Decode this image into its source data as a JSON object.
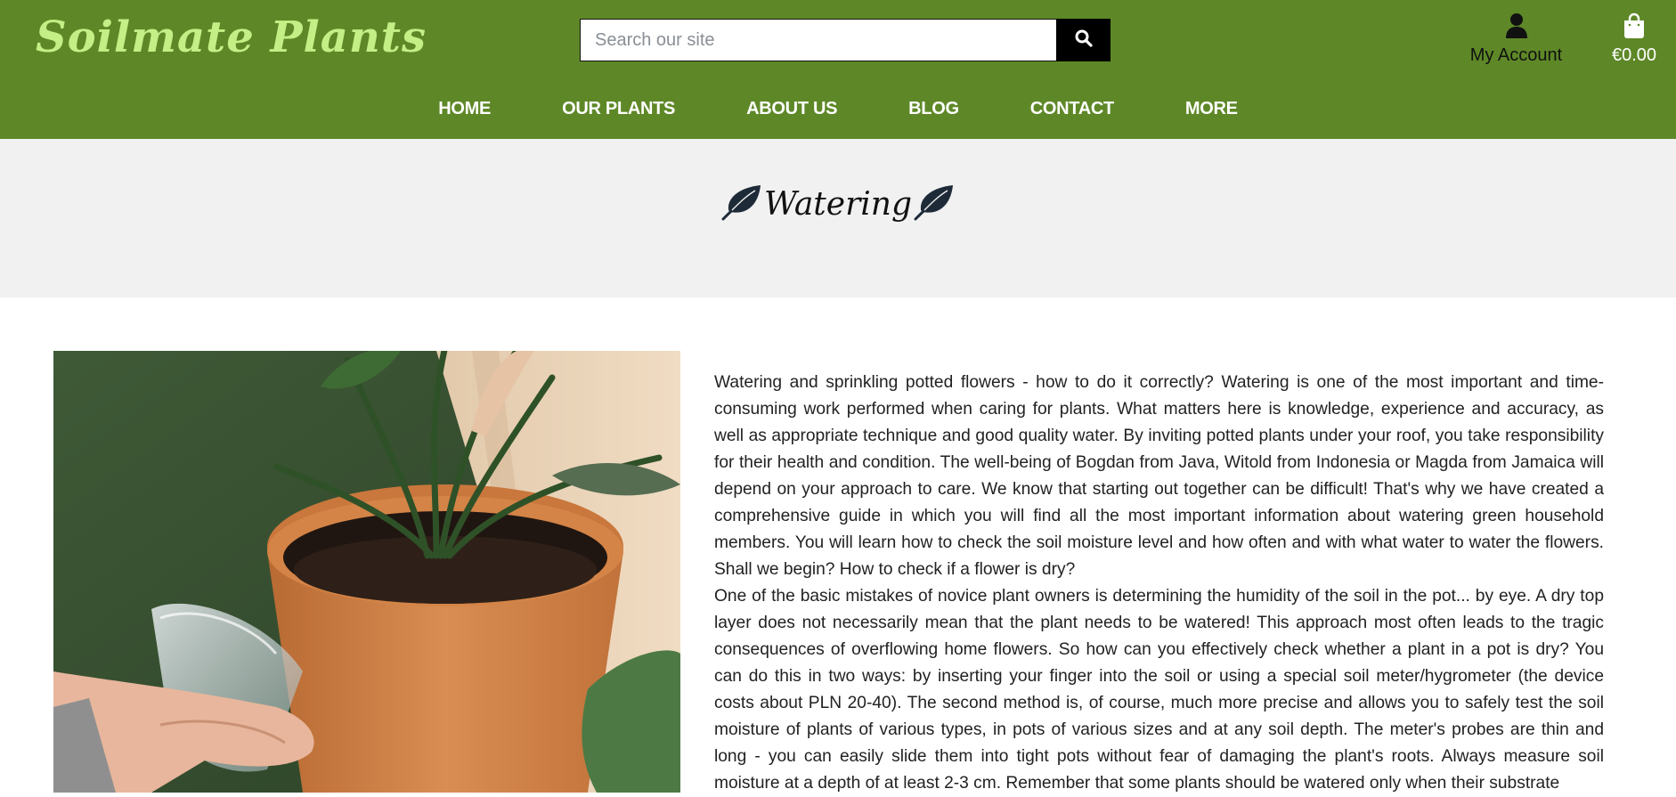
{
  "header": {
    "brand": "Soilmate Plants",
    "search": {
      "placeholder": "Search our site",
      "value": ""
    },
    "account_label": "My Account",
    "cart_total": "€0.00"
  },
  "nav": {
    "items": [
      {
        "label": "HOME"
      },
      {
        "label": "OUR PLANTS"
      },
      {
        "label": "ABOUT US"
      },
      {
        "label": "BLOG"
      },
      {
        "label": "CONTACT"
      },
      {
        "label": "MORE"
      }
    ]
  },
  "banner": {
    "title": "Watering"
  },
  "article": {
    "paragraphs": [
      "Watering and sprinkling potted flowers - how to do it correctly? Watering is one of the most important and time-consuming work performed when caring for plants. What matters here is knowledge, experience and accuracy, as well as appropriate technique and good quality water. By inviting potted plants under your roof, you take responsibility for their health and condition. The well-being of Bogdan from Java, Witold from Indonesia or Magda from Jamaica will depend on your approach to care. We know that starting out together can be difficult! That's why we have created a comprehensive guide in which you will find all the most important information about watering green household members. You will learn how to check the soil moisture level and how often and with what water to water the flowers. Shall we begin? How to check if a flower is dry?",
      "One of the basic mistakes of novice plant owners is determining the humidity of the soil in the pot... by eye. A dry top layer does not necessarily mean that the plant needs to be watered! This approach most often leads to the tragic consequences of overflowing home flowers. So how can you effectively check whether a plant in a pot is dry? You can do this in two ways: by inserting your finger into the soil or using a special soil meter/hygrometer (the device costs about PLN 20-40). The second method is, of course, much more precise and allows you to safely test the soil moisture of plants of various types, in pots of various sizes and at any soil depth. The meter's probes are thin and long - you can easily slide them into tight pots without fear of damaging the plant's roots. Always measure soil moisture at a depth of at least 2-3 cm. Remember that some plants should be watered only when their substrate"
    ]
  },
  "icons": {
    "search": "search-icon",
    "account": "user-icon",
    "cart": "shopping-bag-icon",
    "title_decoration": "leaf-icon"
  },
  "colors": {
    "header_bg": "#5e8827",
    "brand_text": "#c3ef86",
    "banner_bg": "#f1f1f1",
    "search_button": "#000000"
  }
}
